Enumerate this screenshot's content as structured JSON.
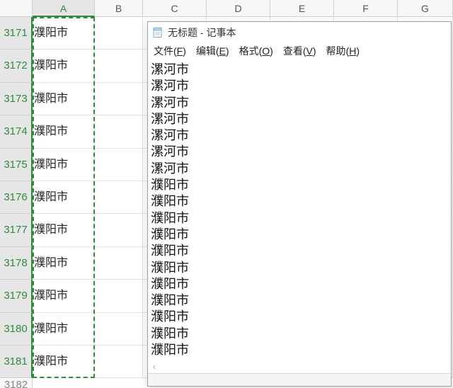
{
  "spreadsheet": {
    "columns": [
      "A",
      "B",
      "C",
      "D",
      "E",
      "F",
      "G"
    ],
    "active_column": "A",
    "rows": [
      {
        "num": 3171,
        "A": "濮阳市"
      },
      {
        "num": 3172,
        "A": "濮阳市"
      },
      {
        "num": 3173,
        "A": "濮阳市"
      },
      {
        "num": 3174,
        "A": "濮阳市"
      },
      {
        "num": 3175,
        "A": "濮阳市"
      },
      {
        "num": 3176,
        "A": "濮阳市"
      },
      {
        "num": 3177,
        "A": "濮阳市"
      },
      {
        "num": 3178,
        "A": "濮阳市"
      },
      {
        "num": 3179,
        "A": "濮阳市"
      },
      {
        "num": 3180,
        "A": "濮阳市"
      },
      {
        "num": 3181,
        "A": "濮阳市"
      }
    ],
    "next_row_num": 3182
  },
  "notepad": {
    "title": "无标题 - 记事本",
    "menu": {
      "file": {
        "label": "文件",
        "access": "F"
      },
      "edit": {
        "label": "编辑",
        "access": "E"
      },
      "format": {
        "label": "格式",
        "access": "O"
      },
      "view": {
        "label": "查看",
        "access": "V"
      },
      "help": {
        "label": "帮助",
        "access": "H"
      }
    },
    "lines": [
      "漯河市",
      "漯河市",
      "漯河市",
      "漯河市",
      "漯河市",
      "漯河市",
      "漯河市",
      "濮阳市",
      "濮阳市",
      "濮阳市",
      "濮阳市",
      "濮阳市",
      "濮阳市",
      "濮阳市",
      "濮阳市",
      "濮阳市",
      "濮阳市",
      "濮阳市"
    ],
    "scroll_hint": "‹"
  }
}
